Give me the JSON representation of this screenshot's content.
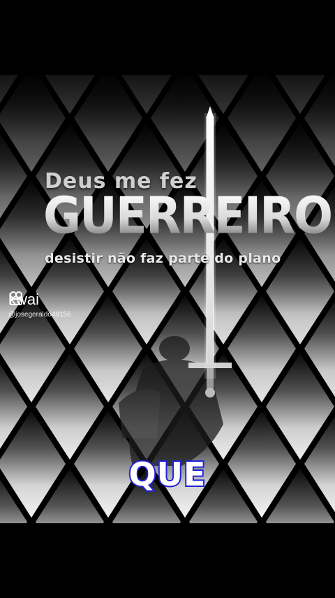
{
  "overlay": {
    "line1": "Deus me fez",
    "line2": "GUERREIRO",
    "line3": "desistir não faz parte do plano"
  },
  "watermark": {
    "brand": "kwai",
    "username": "@josegeraldo49156"
  },
  "caption": {
    "text": "QUE",
    "outline_color": "#2323d8"
  },
  "icons": [
    "kwai-logo-icon",
    "sword-icon"
  ]
}
